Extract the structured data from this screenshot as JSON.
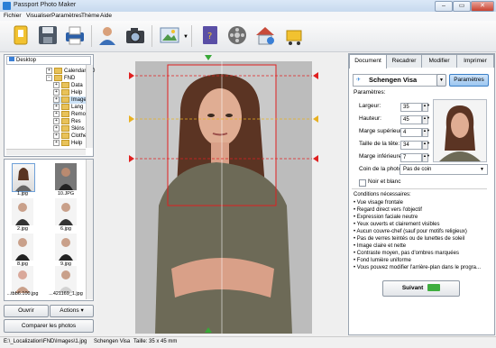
{
  "window": {
    "title": "Passport Photo Maker",
    "minimize": "–",
    "maximize": "▭",
    "close": "✕"
  },
  "menu": [
    "Fichier",
    "Visualiser",
    "Paramètres",
    "Thème",
    "Aide"
  ],
  "toolbar": {
    "icons": [
      "wizard-icon",
      "save-icon",
      "print-icon",
      "user-icon",
      "camera-icon",
      "image-icon",
      "book-icon",
      "film-icon",
      "home-icon",
      "cart-icon"
    ]
  },
  "tree": {
    "drive": "Desktop",
    "items": [
      "Calendar 7.0",
      "FND",
      "Data",
      "Help",
      "Images",
      "Lang",
      "Remote",
      "Res",
      "Skins",
      "Clothes",
      "Help"
    ]
  },
  "thumbs": [
    "1.jpg",
    "10.JPG",
    "2.jpg",
    "6.jpg",
    "8.jpg",
    "9.jpg",
    "...tbb6.100.jpg",
    "...421169_1.jpg"
  ],
  "left_buttons": {
    "open": "Ouvrir",
    "actions": "Actions",
    "compare": "Comparer les photos"
  },
  "tabs": [
    "Document",
    "Recadrer",
    "Modifier",
    "Imprimer"
  ],
  "document": {
    "type": "Schengen Visa",
    "params_button": "Paramètres",
    "params_title": "Paramètres:",
    "fields": [
      {
        "label": "Largeur:",
        "value": "35"
      },
      {
        "label": "Hauteur:",
        "value": "45"
      },
      {
        "label": "Marge supérieure",
        "value": "4"
      },
      {
        "label": "Taille de la tête:",
        "value": "34"
      },
      {
        "label": "Marge inférieure:",
        "value": "7"
      }
    ],
    "corner_label": "Coin de la photo:",
    "corner_value": "Pas de coin",
    "bw_label": "Noir et blanc",
    "conditions_title": "Conditions nécessaires:",
    "conditions": [
      "Vue visage frontale",
      "Regard direct vers l'objectif",
      "Expression faciale neutre",
      "Yeux ouverts et clairement visibles",
      "Aucun couvre-chef (sauf pour motifs religieux)",
      "Pas de verres teintés ou de lunettes de soleil",
      "Image claire et nette",
      "Contraste moyen, pas d'ombres marquées",
      "Fond lumière uniforme",
      "Vous pouvez modifier l'arrière-plan dans le progra..."
    ],
    "next_button": "Suivant"
  },
  "status": {
    "path": "E:\\_Localization\\FND\\Images\\1.jpg",
    "doc": "Schengen Visa",
    "size": "Taille: 35 x 45 mm"
  },
  "colors": {
    "accent": "#2b7fd6",
    "guide_red": "#e02020",
    "guide_yellow": "#e8b020",
    "arrow_green": "#38a838",
    "next_green": "#3fae3f"
  }
}
